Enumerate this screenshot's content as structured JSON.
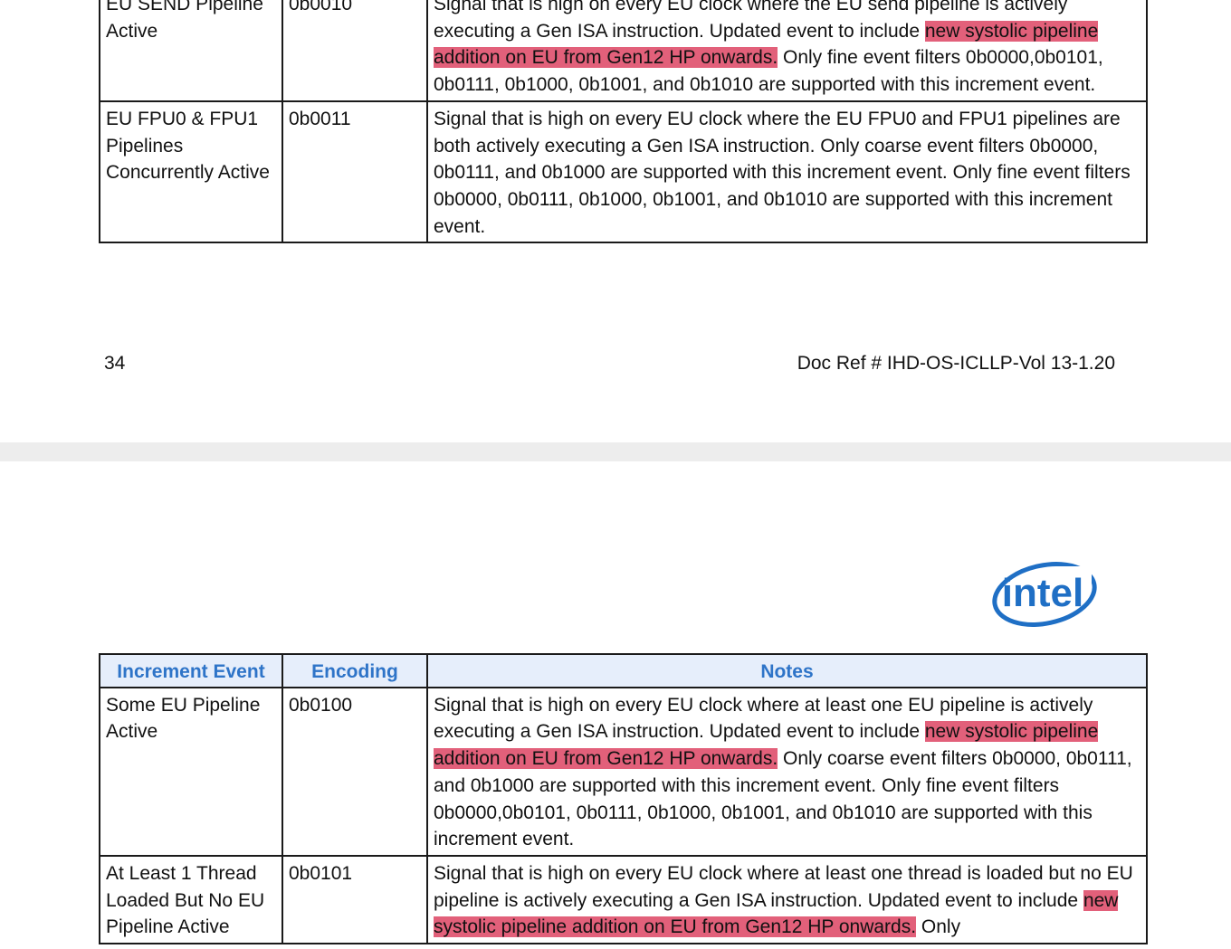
{
  "page1": {
    "rows": [
      {
        "event": "EU SEND Pipeline Active",
        "encoding": "0b0010",
        "notes_pre": "Signal that is high on every EU clock where the EU send pipeline is actively executing a Gen ISA instruction. Updated event to include ",
        "notes_hl": "new systolic pipeline addition on EU from Gen12 HP onwards.",
        "notes_post": " Only fine event filters 0b0000,0b0101, 0b0111, 0b1000, 0b1001, and 0b1010 are supported with this increment event."
      },
      {
        "event": "EU FPU0 & FPU1 Pipelines Concurrently Active",
        "encoding": "0b0011",
        "notes_pre": "Signal that is high on every EU clock where the EU FPU0 and FPU1 pipelines are both actively executing a Gen ISA instruction. Only coarse event filters 0b0000, 0b0111, and 0b1000 are supported with this increment event. Only fine event filters 0b0000, 0b0111, 0b1000, 0b1001, and 0b1010 are supported with this increment event.",
        "notes_hl": "",
        "notes_post": ""
      }
    ],
    "footer": {
      "page_number": "34",
      "doc_ref": "Doc Ref # IHD-OS-ICLLP-Vol 13-1.20"
    }
  },
  "page2": {
    "logo_text": "intel",
    "headers": {
      "event": "Increment Event",
      "encoding": "Encoding",
      "notes": "Notes"
    },
    "rows": [
      {
        "event": "Some EU Pipeline Active",
        "encoding": "0b0100",
        "notes_pre": "Signal that is high on every EU clock where at least one EU pipeline is actively executing a Gen ISA instruction. Updated event to include ",
        "notes_hl": "new systolic pipeline addition on EU from Gen12 HP onwards.",
        "notes_post": " Only coarse event filters 0b0000, 0b0111, and 0b1000 are supported with this increment event. Only fine event filters 0b0000,0b0101, 0b0111, 0b1000, 0b1001, and 0b1010 are supported with this increment event."
      },
      {
        "event": "At Least 1 Thread Loaded But No EU Pipeline Active",
        "encoding": "0b0101",
        "notes_pre": "Signal that is high on every EU clock where at least one thread is loaded but no EU pipeline is actively executing a Gen ISA instruction. Updated event to include ",
        "notes_hl": "new systolic pipeline addition on EU from Gen12 HP onwards.",
        "notes_post": " Only"
      }
    ]
  },
  "colors": {
    "highlight": "#e2607a",
    "header_text": "#2e74c8",
    "header_bg": "#e6eefb",
    "logo": "#1f6fc5",
    "page_gap": "#ededed"
  }
}
